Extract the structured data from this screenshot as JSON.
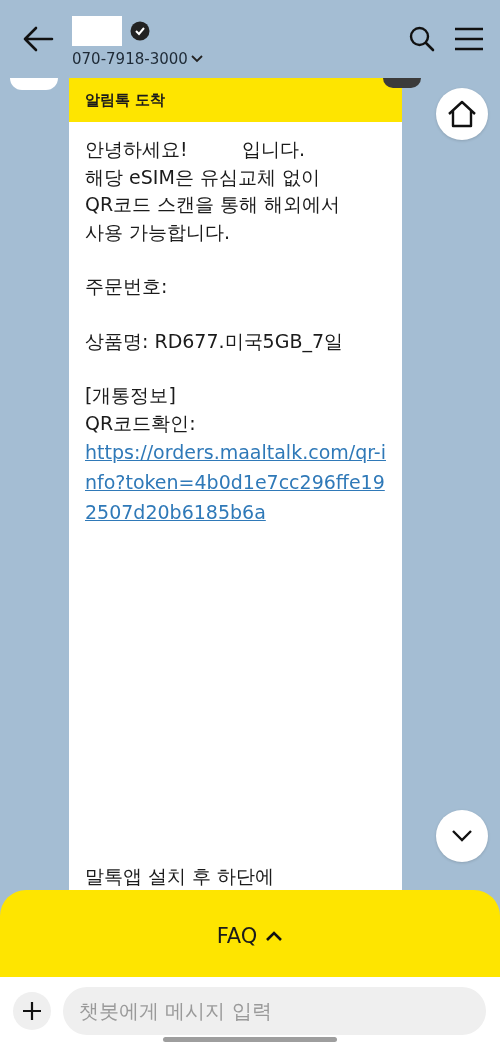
{
  "header": {
    "phone": "070-7918-3000"
  },
  "message": {
    "label": "알림톡 도착",
    "paragraphs": [
      {
        "kind": "text",
        "lines": [
          "안녕하세요!         입니다.",
          "해당 eSIM은 유심교체 없이",
          "QR코드 스캔을 통해 해외에서",
          "사용 가능합니다."
        ]
      },
      {
        "kind": "text",
        "lines": [
          "주문번호:"
        ]
      },
      {
        "kind": "text",
        "lines": [
          "상품명: RD677.미국5GB_7일"
        ]
      },
      {
        "kind": "text",
        "lines": [
          "[개통정보]",
          "QR코드확인:"
        ]
      },
      {
        "kind": "link",
        "text": "https://orders.maaltalk.com/qr-info?token=4b0d1e7cc296ffe192507d20b6185b6a"
      },
      {
        "kind": "text",
        "lines": [
          "말톡앱 설치 후 하단에"
        ]
      }
    ]
  },
  "faq": {
    "label": "FAQ"
  },
  "composer": {
    "placeholder": "챗봇에게 메시지 입력"
  }
}
